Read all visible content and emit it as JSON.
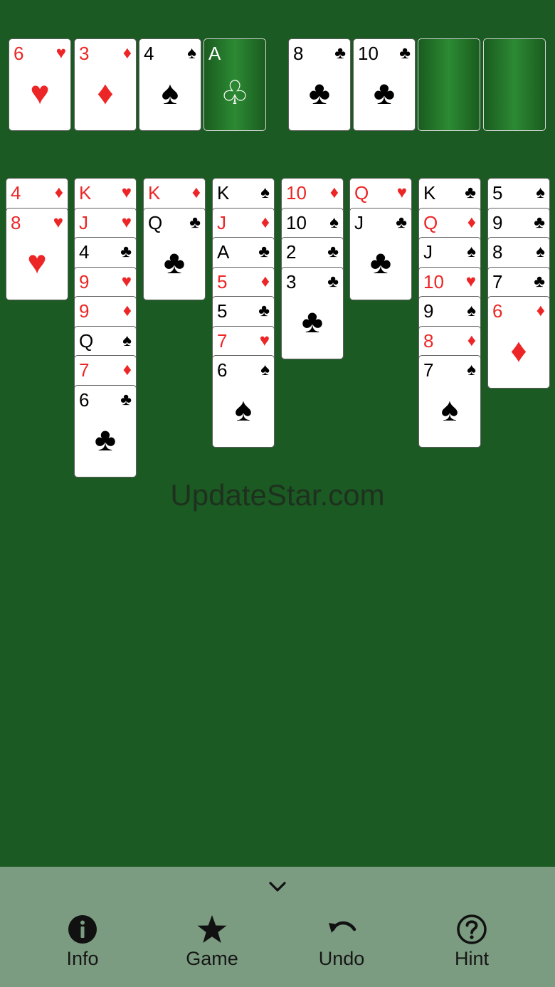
{
  "foundations": [
    {
      "rank": "6",
      "suit": "♥",
      "color": "red"
    },
    {
      "rank": "3",
      "suit": "♦",
      "color": "red"
    },
    {
      "rank": "4",
      "suit": "♠",
      "color": "black"
    },
    {
      "rank": "A",
      "suit": "♧",
      "color": "ghost"
    }
  ],
  "free_cells": [
    {
      "rank": "8",
      "suit": "♣",
      "color": "black"
    },
    {
      "rank": "10",
      "suit": "♣",
      "color": "black"
    },
    {
      "empty": true
    },
    {
      "empty": true
    }
  ],
  "tableau": [
    [
      {
        "rank": "4",
        "suit": "♦",
        "color": "red"
      },
      {
        "rank": "8",
        "suit": "♥",
        "color": "red"
      }
    ],
    [
      {
        "rank": "K",
        "suit": "♥",
        "color": "red"
      },
      {
        "rank": "J",
        "suit": "♥",
        "color": "red"
      },
      {
        "rank": "4",
        "suit": "♣",
        "color": "black"
      },
      {
        "rank": "9",
        "suit": "♥",
        "color": "red"
      },
      {
        "rank": "9",
        "suit": "♦",
        "color": "red"
      },
      {
        "rank": "Q",
        "suit": "♠",
        "color": "black"
      },
      {
        "rank": "7",
        "suit": "♦",
        "color": "red"
      },
      {
        "rank": "6",
        "suit": "♣",
        "color": "black"
      }
    ],
    [
      {
        "rank": "K",
        "suit": "♦",
        "color": "red"
      },
      {
        "rank": "Q",
        "suit": "♣",
        "color": "black"
      }
    ],
    [
      {
        "rank": "K",
        "suit": "♠",
        "color": "black"
      },
      {
        "rank": "J",
        "suit": "♦",
        "color": "red"
      },
      {
        "rank": "A",
        "suit": "♣",
        "color": "black"
      },
      {
        "rank": "5",
        "suit": "♦",
        "color": "red"
      },
      {
        "rank": "5",
        "suit": "♣",
        "color": "black"
      },
      {
        "rank": "7",
        "suit": "♥",
        "color": "red"
      },
      {
        "rank": "6",
        "suit": "♠",
        "color": "black"
      }
    ],
    [
      {
        "rank": "10",
        "suit": "♦",
        "color": "red"
      },
      {
        "rank": "10",
        "suit": "♠",
        "color": "black"
      },
      {
        "rank": "2",
        "suit": "♣",
        "color": "black"
      },
      {
        "rank": "3",
        "suit": "♣",
        "color": "black"
      }
    ],
    [
      {
        "rank": "Q",
        "suit": "♥",
        "color": "red"
      },
      {
        "rank": "J",
        "suit": "♣",
        "color": "black"
      }
    ],
    [
      {
        "rank": "K",
        "suit": "♣",
        "color": "black"
      },
      {
        "rank": "Q",
        "suit": "♦",
        "color": "red"
      },
      {
        "rank": "J",
        "suit": "♠",
        "color": "black"
      },
      {
        "rank": "10",
        "suit": "♥",
        "color": "red"
      },
      {
        "rank": "9",
        "suit": "♠",
        "color": "black"
      },
      {
        "rank": "8",
        "suit": "♦",
        "color": "red"
      },
      {
        "rank": "7",
        "suit": "♠",
        "color": "black"
      }
    ],
    [
      {
        "rank": "5",
        "suit": "♠",
        "color": "black"
      },
      {
        "rank": "9",
        "suit": "♣",
        "color": "black"
      },
      {
        "rank": "8",
        "suit": "♠",
        "color": "black"
      },
      {
        "rank": "7",
        "suit": "♣",
        "color": "black"
      },
      {
        "rank": "6",
        "suit": "♦",
        "color": "red"
      }
    ]
  ],
  "watermark": "UpdateStar.com",
  "toolbar": {
    "collapse_icon": "chevron-down-icon",
    "info_label": "Info",
    "game_label": "Game",
    "undo_label": "Undo",
    "hint_label": "Hint"
  },
  "colors": {
    "felt": "#1b5a22",
    "toolbar": "#7b9c81",
    "red_suit": "#ec2626"
  }
}
